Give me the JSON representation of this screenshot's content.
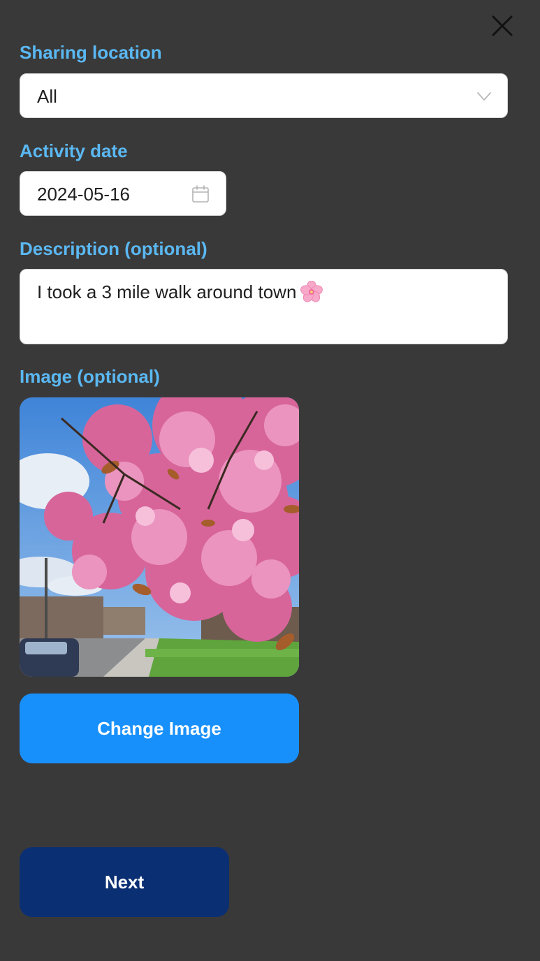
{
  "form": {
    "sharing_location": {
      "label": "Sharing location",
      "value": "All"
    },
    "activity_date": {
      "label": "Activity date",
      "value": "2024-05-16"
    },
    "description": {
      "label": "Description (optional)",
      "value": "I took a 3 mile walk around town"
    },
    "image": {
      "label": "Image (optional)",
      "change_label": "Change Image"
    }
  },
  "footer": {
    "next_label": "Next"
  },
  "icons": {
    "close": "close-icon",
    "dropdown": "chevron-down-icon",
    "calendar": "calendar-icon",
    "emoji": "cherry-blossom-icon"
  },
  "colors": {
    "background": "#3a3939",
    "label": "#5ab8f2",
    "primary_button": "#1890fb",
    "next_button": "#0b2f73"
  }
}
